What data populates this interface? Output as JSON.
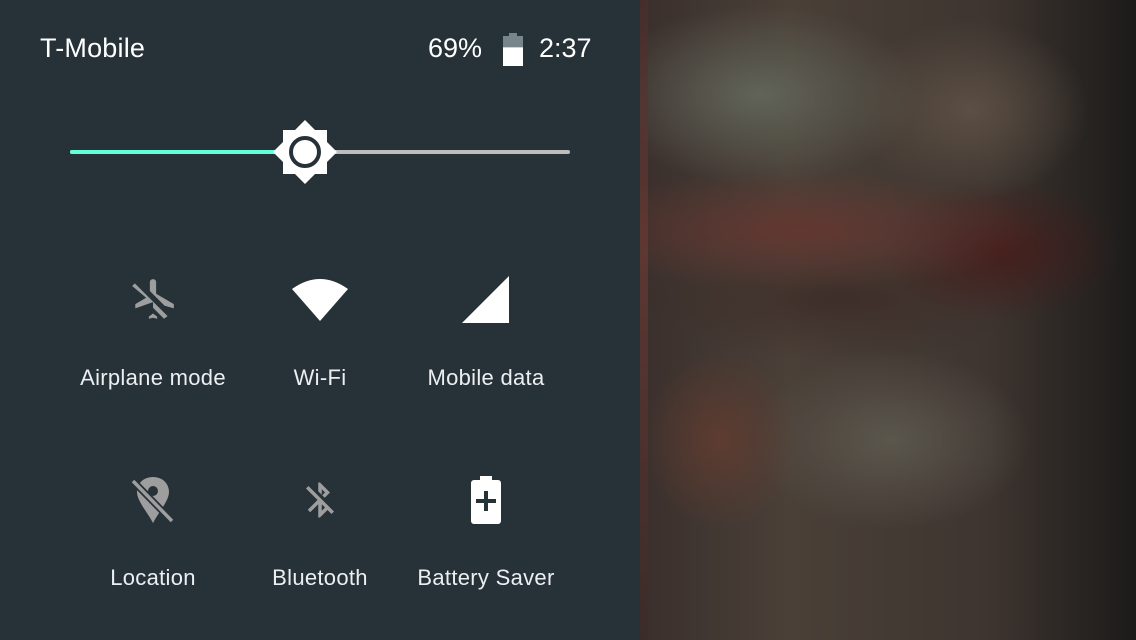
{
  "status_bar": {
    "carrier": "T-Mobile",
    "battery_percent": "69%",
    "battery_level": 0.69,
    "time": "2:37"
  },
  "brightness": {
    "level": 0.47,
    "accent_color": "#64ffda",
    "track_color": "#bdbdbd",
    "icon": "brightness-auto-icon"
  },
  "tiles": [
    {
      "label": "Airplane mode",
      "icon": "airplane-off-icon",
      "state": "off"
    },
    {
      "label": "Wi-Fi",
      "icon": "wifi-icon",
      "state": "on"
    },
    {
      "label": "Mobile data",
      "icon": "cellular-signal-icon",
      "state": "on"
    },
    {
      "label": "Location",
      "icon": "location-off-icon",
      "state": "off"
    },
    {
      "label": "Bluetooth",
      "icon": "bluetooth-off-icon",
      "state": "off"
    },
    {
      "label": "Battery Saver",
      "icon": "battery-saver-icon",
      "state": "on"
    }
  ],
  "colors": {
    "panel_bg": "#263238",
    "icon_on": "#ffffff",
    "icon_off": "#9e9e9e"
  }
}
